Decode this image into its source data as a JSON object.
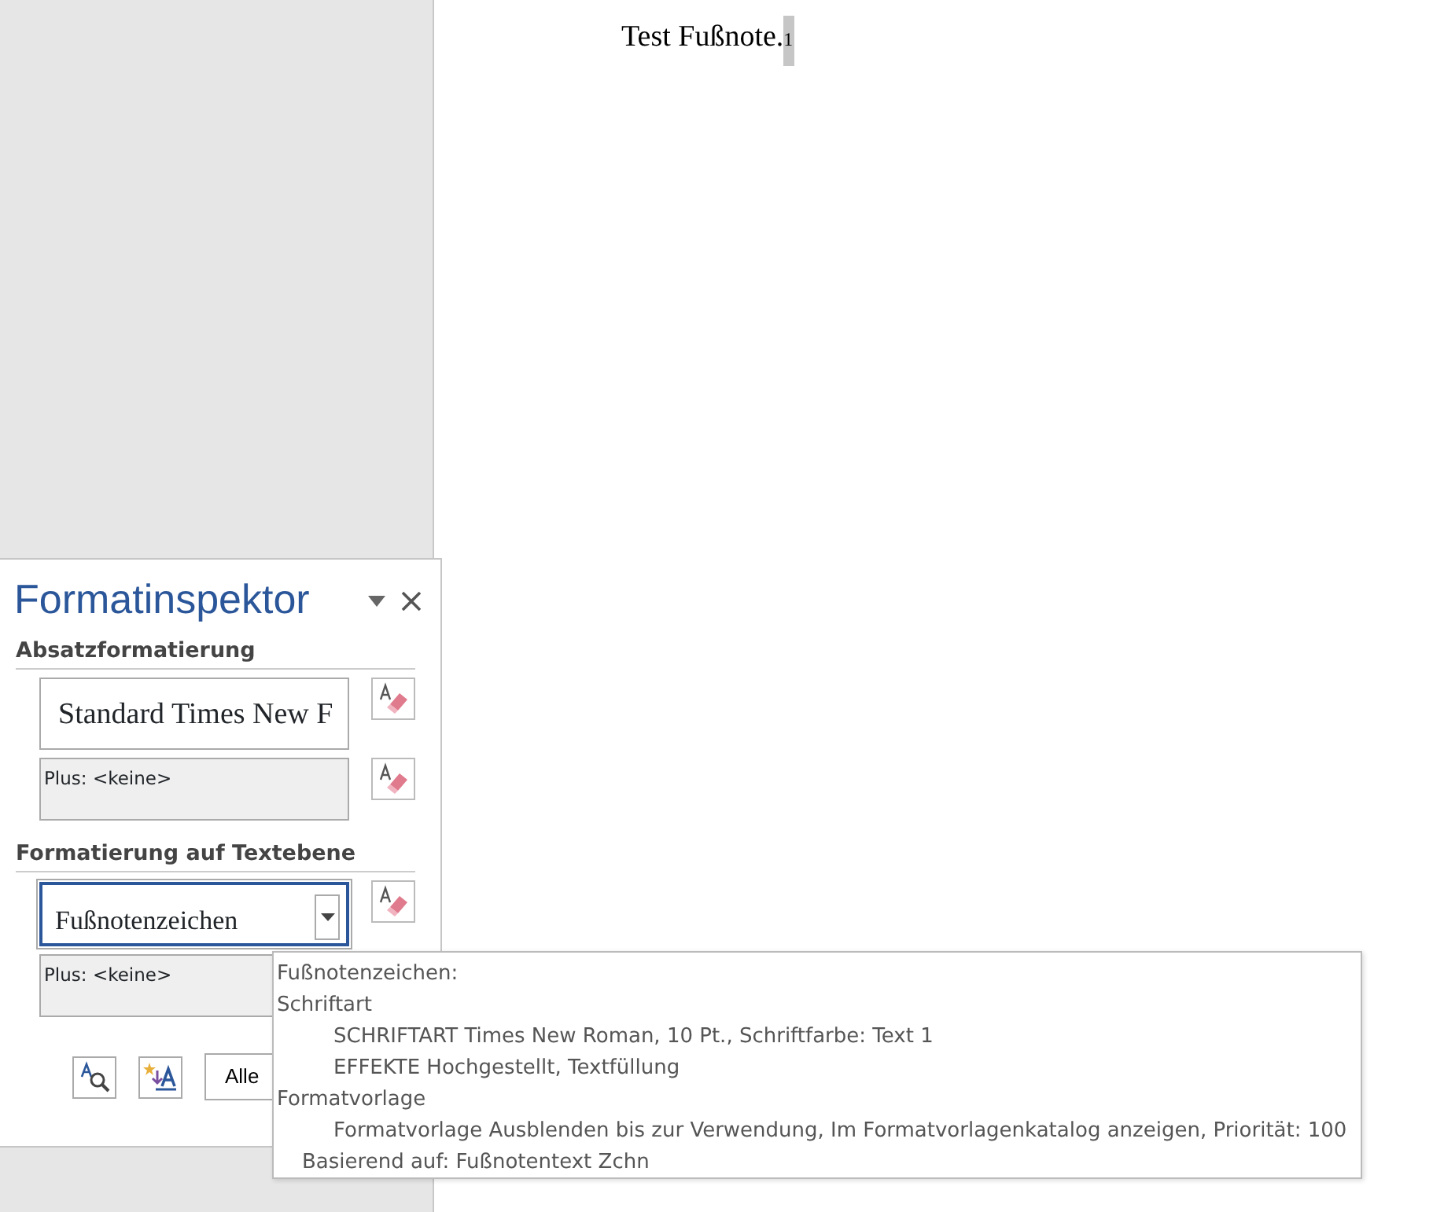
{
  "document": {
    "text": "Test Fußnote.",
    "footnote_mark": "1",
    "footnote_selected": true
  },
  "panel": {
    "title": "Formatinspektor",
    "sections": [
      {
        "heading": "Absatzformatierung",
        "style_field": {
          "kind": "text",
          "value": "Standard Times New F"
        },
        "plus_text": "Plus: <keine>"
      },
      {
        "heading": "Formatierung auf Textebene",
        "style_field": {
          "kind": "dropdown",
          "value": "Fußnotenzeichen"
        },
        "plus_text": "Plus: <keine>"
      }
    ],
    "footer_button": "Alle"
  },
  "tooltip": {
    "lines": [
      {
        "kind": "heading",
        "text": "Fußnotenzeichen:"
      },
      {
        "kind": "heading",
        "text": "Schriftart"
      },
      {
        "kind": "detail",
        "text": "SCHRIFTART Times New Roman, 10 Pt., Schriftfarbe: Text 1"
      },
      {
        "kind": "detail",
        "text": "EFFEKTE Hochgestellt, Textfüllung"
      },
      {
        "kind": "heading",
        "text": "Formatvorlage"
      },
      {
        "kind": "detail",
        "text": "Formatvorlage Ausblenden bis zur Verwendung, Im Formatvorlagenkatalog anzeigen, Priorität: 100"
      },
      {
        "kind": "basis",
        "text": "Basierend auf: Fußnotentext Zchn"
      }
    ]
  }
}
